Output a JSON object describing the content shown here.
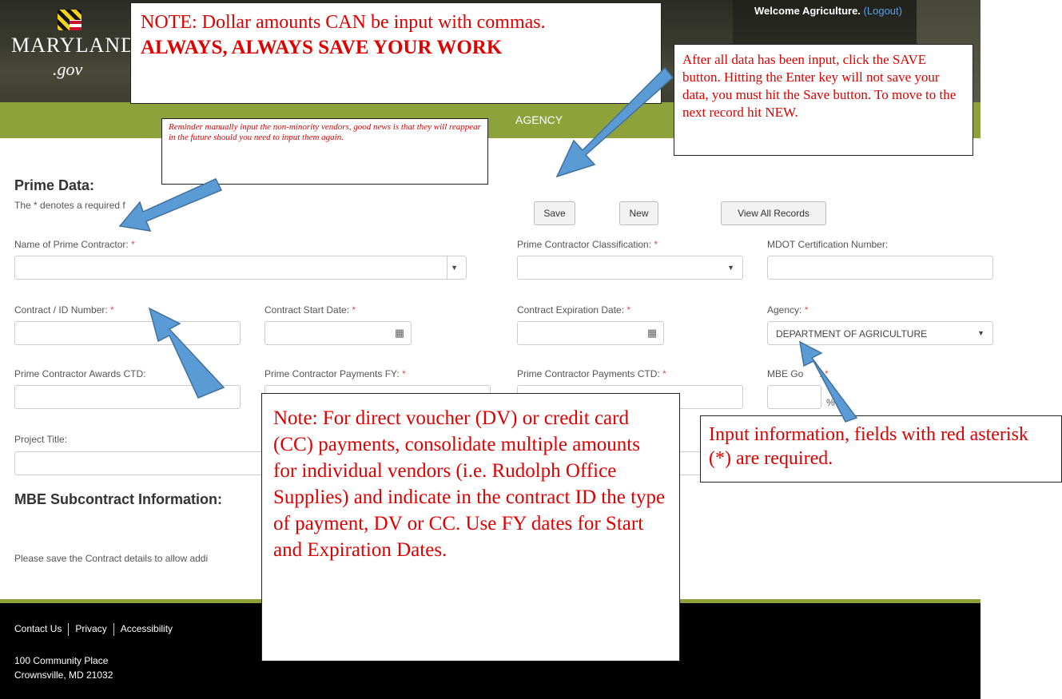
{
  "header": {
    "logo_state": "MARYLAND",
    "logo_domain": ".gov",
    "welcome_text": "Welcome Agriculture.",
    "logout_link": "(Logout)",
    "nav_agency": "AGENCY"
  },
  "form": {
    "section_title": "Prime Data:",
    "required_note": "The * denotes a required f",
    "buttons": {
      "save": "Save",
      "new": "New",
      "view_all": "View All Records"
    },
    "fields": {
      "prime_contractor_name": {
        "label": "Name of Prime Contractor:",
        "value": ""
      },
      "prime_contractor_classification": {
        "label": "Prime Contractor Classification:",
        "value": ""
      },
      "mdot_cert": {
        "label": "MDOT Certification Number:",
        "value": ""
      },
      "contract_id": {
        "label": "Contract / ID Number:",
        "value": ""
      },
      "contract_start": {
        "label": "Contract Start Date:",
        "value": ""
      },
      "contract_expiration": {
        "label": "Contract Expiration Date:",
        "value": ""
      },
      "agency": {
        "label": "Agency:",
        "value": "DEPARTMENT OF AGRICULTURE"
      },
      "awards_ctd": {
        "label": "Prime Contractor Awards CTD:",
        "value": ""
      },
      "payments_fy": {
        "label": "Prime Contractor Payments FY:",
        "value": ""
      },
      "payments_ctd": {
        "label": "Prime Contractor Payments CTD:",
        "value": ""
      },
      "mbe_goal": {
        "label": "MBE Go",
        "label_tail": ":",
        "suffix": "%",
        "value": ""
      },
      "project_title": {
        "label": "Project Title:",
        "value": ""
      }
    },
    "required_star": "*"
  },
  "mbe": {
    "title": "MBE Subcontract Information:",
    "save_note": "Please save the Contract details to allow addi"
  },
  "footer": {
    "links": [
      "Contact Us",
      "Privacy",
      "Accessibility"
    ],
    "address_line1": "100 Community Place",
    "address_line2": "Crownsville, MD 21032"
  },
  "annotations": {
    "note_commas": "NOTE:  Dollar amounts CAN be input with commas.",
    "note_save": "ALWAYS, ALWAYS SAVE YOUR WORK",
    "note_save_button": "After all data has been input, click the SAVE button.  Hitting the Enter key will not save your data, you must hit the Save button.  To move to the next record hit NEW.",
    "note_reminder": "Reminder manually input the non-minority vendors, good news is that they will reappear in the future should you need to input them again.",
    "note_dv_cc": "Note:  For direct voucher (DV) or credit card (CC) payments, consolidate multiple amounts for individual vendors (i.e. Rudolph Office Supplies) and indicate in the contract ID the type of payment, DV or CC.  Use FY dates for Start and Expiration Dates.",
    "note_required": "Input information, fields with red asterisk (*) are required."
  },
  "colors": {
    "nav_green": "#8da23b",
    "annotation_red": "#e00000",
    "arrow_blue": "#5b9bd5",
    "required_red": "#d9534f"
  }
}
